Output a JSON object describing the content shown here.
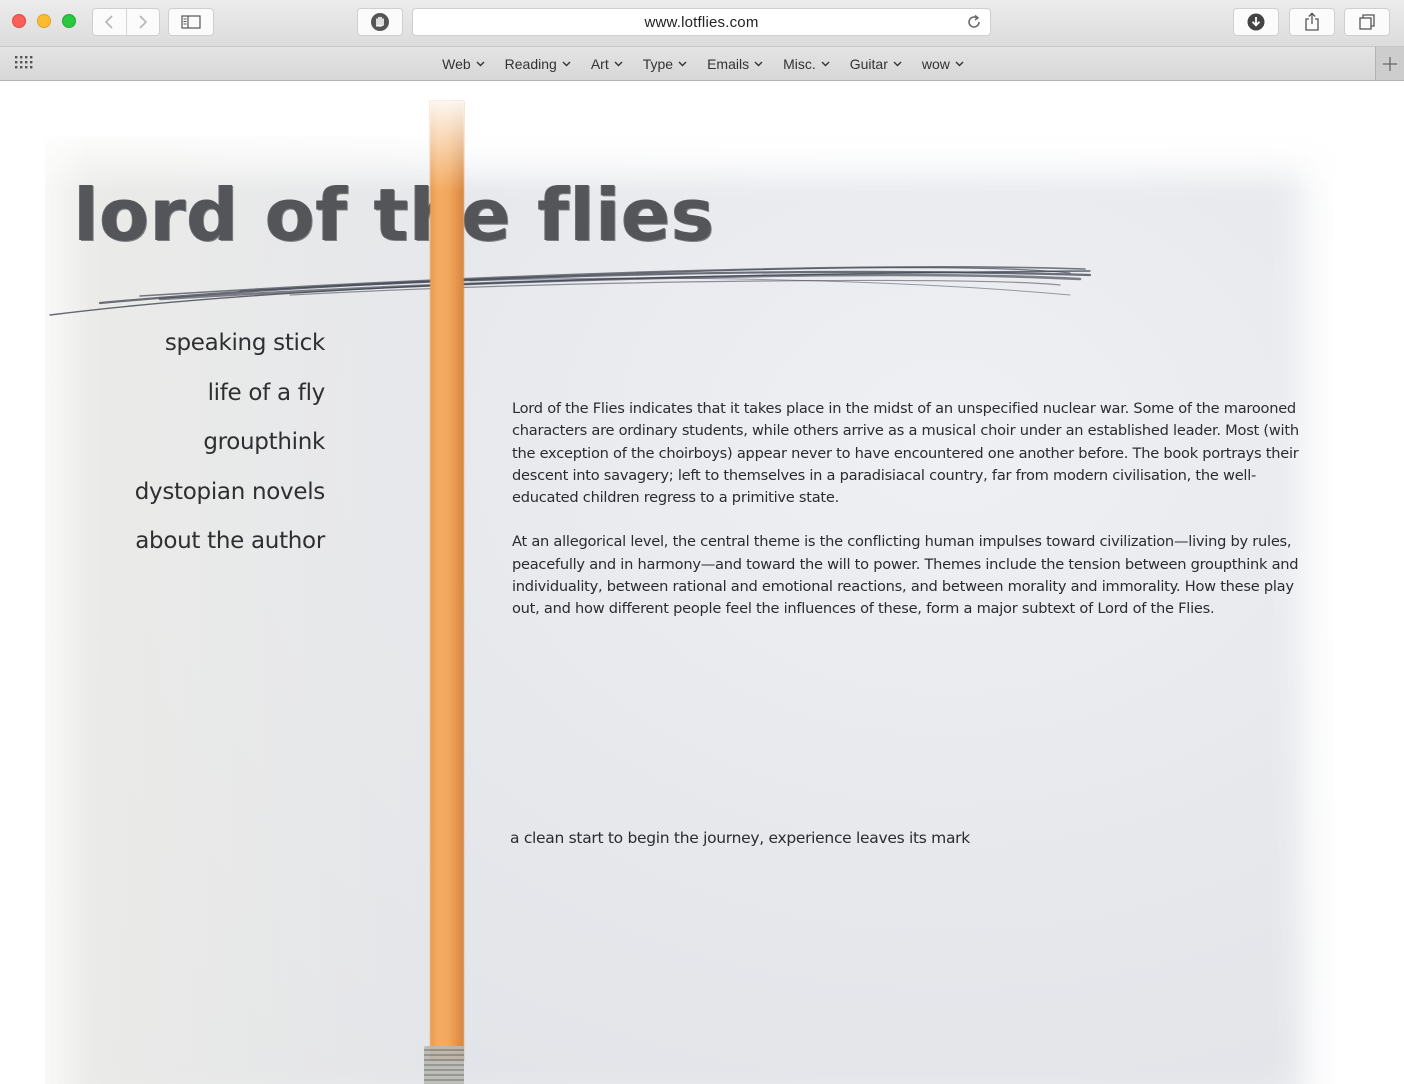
{
  "browser": {
    "url": "www.lotflies.com",
    "bookmarks": [
      {
        "label": "Web"
      },
      {
        "label": "Reading"
      },
      {
        "label": "Art"
      },
      {
        "label": "Type"
      },
      {
        "label": "Emails"
      },
      {
        "label": "Misc."
      },
      {
        "label": "Guitar"
      },
      {
        "label": "wow"
      }
    ],
    "icons": {
      "back": "chevron-left-icon",
      "forward": "chevron-right-icon",
      "sidebar": "sidebar-icon",
      "privacy": "hand-icon",
      "reload": "reload-icon",
      "download": "download-icon",
      "share": "share-icon",
      "tabs": "tabs-icon",
      "top_sites": "grid-icon",
      "new_tab": "plus-icon"
    }
  },
  "page": {
    "title": "lord of the flies",
    "nav": [
      {
        "label": "speaking stick"
      },
      {
        "label": "life of a fly"
      },
      {
        "label": "groupthink"
      },
      {
        "label": "dystopian novels"
      },
      {
        "label": "about the author"
      }
    ],
    "paragraphs": [
      "Lord of the Flies indicates that it takes place in the midst of an unspecified nuclear war. Some of the marooned characters are ordinary students, while others arrive as a musical choir under an established leader. Most (with the exception of the choirboys) appear never to have encountered one another before. The book portrays their descent into savagery; left to themselves in a paradisiacal country, far from modern civilisation, the well-educated children regress to a primitive state.",
      "At an allegorical level, the central theme is the conflicting human impulses toward civilization—living by rules, peacefully and in harmony—and toward the will to power. Themes include the tension between groupthink and individuality, between rational and emotional reactions, and between morality and immorality. How these play out, and how different people feel the influences of these, form a major subtext of Lord of the Flies."
    ],
    "tagline": "a clean start to begin the journey, experience leaves its mark"
  },
  "colors": {
    "pencil": "#f2a75c",
    "ink": "#3b3c40",
    "paper": "#e6e8ec"
  }
}
